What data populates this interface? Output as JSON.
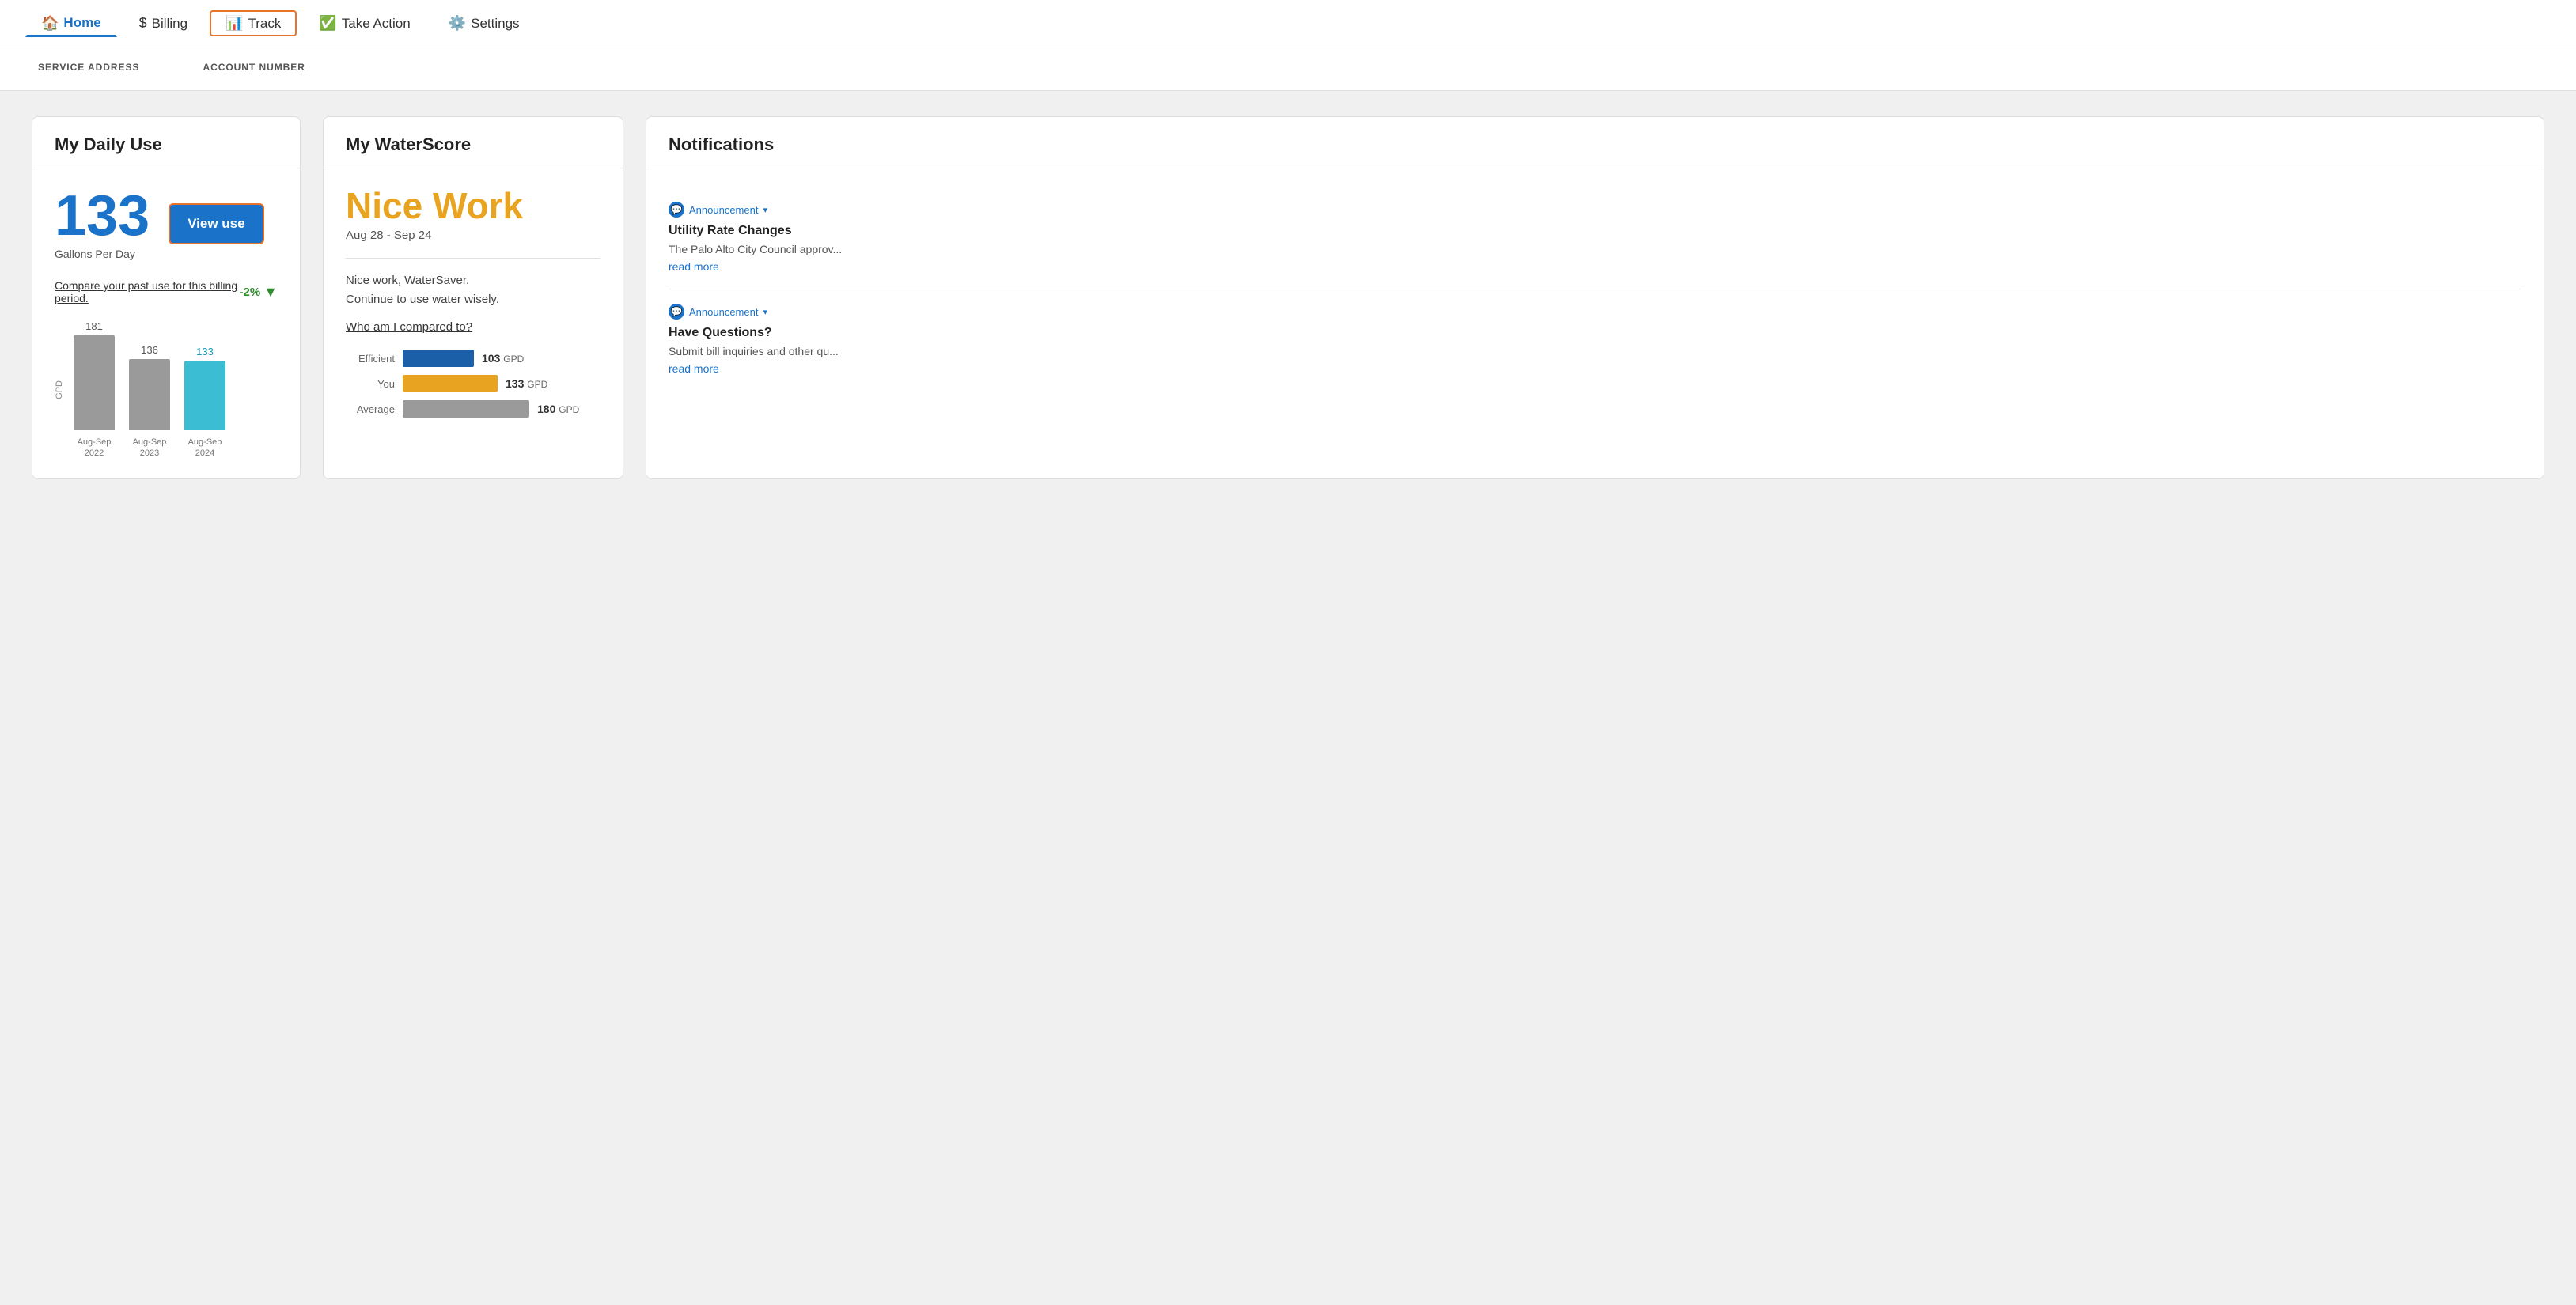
{
  "nav": {
    "items": [
      {
        "id": "home",
        "icon": "🏠",
        "label": "Home",
        "active": true,
        "highlighted": false
      },
      {
        "id": "billing",
        "icon": "$",
        "label": "Billing",
        "active": false,
        "highlighted": false
      },
      {
        "id": "track",
        "icon": "📊",
        "label": "Track",
        "active": false,
        "highlighted": true
      },
      {
        "id": "take-action",
        "icon": "✅",
        "label": "Take Action",
        "active": false,
        "highlighted": false
      },
      {
        "id": "settings",
        "icon": "⚙️",
        "label": "Settings",
        "active": false,
        "highlighted": false
      }
    ]
  },
  "header": {
    "service_address_label": "SERVICE ADDRESS",
    "account_number_label": "ACCOUNT NUMBER"
  },
  "daily_use_card": {
    "title": "My Daily Use",
    "gallons": "133",
    "unit": "Gallons Per Day",
    "view_use_label": "View use",
    "compare_link": "Compare your past use for this billing period.",
    "change_pct": "-2%",
    "bars": [
      {
        "value": "181",
        "label": "Aug-Sep\n2022",
        "type": "gray",
        "height": 120
      },
      {
        "value": "136",
        "label": "Aug-Sep\n2023",
        "type": "gray",
        "height": 90
      },
      {
        "value": "133",
        "label": "Aug-Sep\n2024",
        "type": "teal",
        "height": 88,
        "highlight": true
      }
    ],
    "gpd_label": "GPD"
  },
  "waterscore_card": {
    "title": "My WaterScore",
    "score_text": "Nice Work",
    "date_range": "Aug 28 - Sep 24",
    "message": "Nice work, WaterSaver.\nContinue to use water wisely.",
    "compare_link": "Who am I compared to?",
    "comparisons": [
      {
        "label": "Efficient",
        "type": "efficient",
        "value": "103",
        "unit": "GPD",
        "width": 90
      },
      {
        "label": "You",
        "type": "you",
        "value": "133",
        "unit": "GPD",
        "width": 120
      },
      {
        "label": "Average",
        "type": "average",
        "value": "180",
        "unit": "GPD",
        "width": 160
      }
    ]
  },
  "notifications_card": {
    "title": "Notifications",
    "items": [
      {
        "tag": "Announcement",
        "title": "Utility Rate Changes",
        "text": "The Palo Alto City Council approv...",
        "read_more": "read more"
      },
      {
        "tag": "Announcement",
        "title": "Have Questions?",
        "text": "Submit bill inquiries and other qu...",
        "read_more": "read more"
      }
    ]
  }
}
